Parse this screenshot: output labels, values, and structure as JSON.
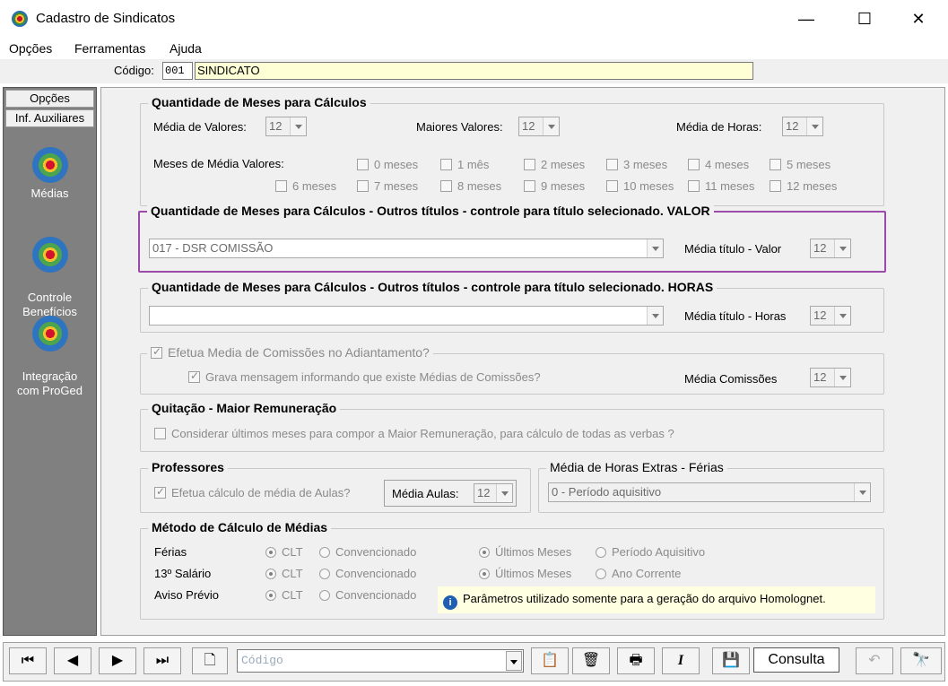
{
  "window": {
    "title": "Cadastro de Sindicatos",
    "minimize": "—",
    "maximize": "☐",
    "close": "✕"
  },
  "menu": [
    "Opções",
    "Ferramentas",
    "Ajuda"
  ],
  "code": {
    "label": "Código:",
    "number": "001",
    "name": "SINDICATO"
  },
  "sidebar": {
    "tabs": [
      "Opções",
      "Inf. Auxiliares"
    ],
    "items": [
      {
        "label": "Médias"
      },
      {
        "label": "Controle\nBenefícios"
      },
      {
        "label": "Integração\ncom ProGed"
      }
    ]
  },
  "group1": {
    "title": "Quantidade de Meses para Cálculos",
    "media_valores_label": "Média de Valores:",
    "media_valores": "12",
    "maiores_valores_label": "Maiores Valores:",
    "maiores_valores": "12",
    "media_horas_label": "Média de Horas:",
    "media_horas": "12",
    "meses_label": "Meses de Média Valores:",
    "meses": [
      "0 meses",
      "1 mês",
      "2 meses",
      "3 meses",
      "4 meses",
      "5 meses",
      "6 meses",
      "7 meses",
      "8 meses",
      "9 meses",
      "10 meses",
      "11 meses",
      "12 meses"
    ]
  },
  "group2": {
    "title": "Quantidade de Meses para Cálculos - Outros títulos - controle para título selecionado. VALOR",
    "combo": "017 - DSR COMISSÃO",
    "media_label": "Média título - Valor",
    "media": "12"
  },
  "group3": {
    "title": "Quantidade de Meses para Cálculos - Outros títulos - controle para título selecionado. HORAS",
    "combo": "",
    "media_label": "Média título - Horas",
    "media": "12"
  },
  "group4": {
    "title": "Efetua Media de Comissões no Adiantamento?",
    "sub": "Grava mensagem informando que existe Médias de Comissões?",
    "media_label": "Média Comissões",
    "media": "12"
  },
  "group5": {
    "title": "Quitação - Maior Remuneração",
    "check": "Considerar últimos meses para compor a Maior Remuneração, para cálculo de todas as verbas ?"
  },
  "group6": {
    "title": "Professores",
    "check": "Efetua cálculo de média de Aulas?",
    "media_label": "Média Aulas:",
    "media": "12"
  },
  "group7": {
    "title": "Média de Horas Extras - Férias",
    "combo": "0 - Período aquisitivo"
  },
  "group8": {
    "title": "Método de Cálculo de Médias",
    "rows": [
      {
        "label": "Férias",
        "a": "CLT",
        "b": "Convencionado",
        "c": "Últimos Meses",
        "d": "Período Aquisitivo"
      },
      {
        "label": "13º Salário",
        "a": "CLT",
        "b": "Convencionado",
        "c": "Últimos Meses",
        "d": "Ano Corrente"
      },
      {
        "label": "Aviso Prévio",
        "a": "CLT",
        "b": "Convencionado"
      }
    ],
    "info": "Parâmetros utilizado somente para a geração do arquivo Homolognet."
  },
  "toolbar": {
    "search_placeholder": "Código",
    "consulta": "Consulta"
  }
}
